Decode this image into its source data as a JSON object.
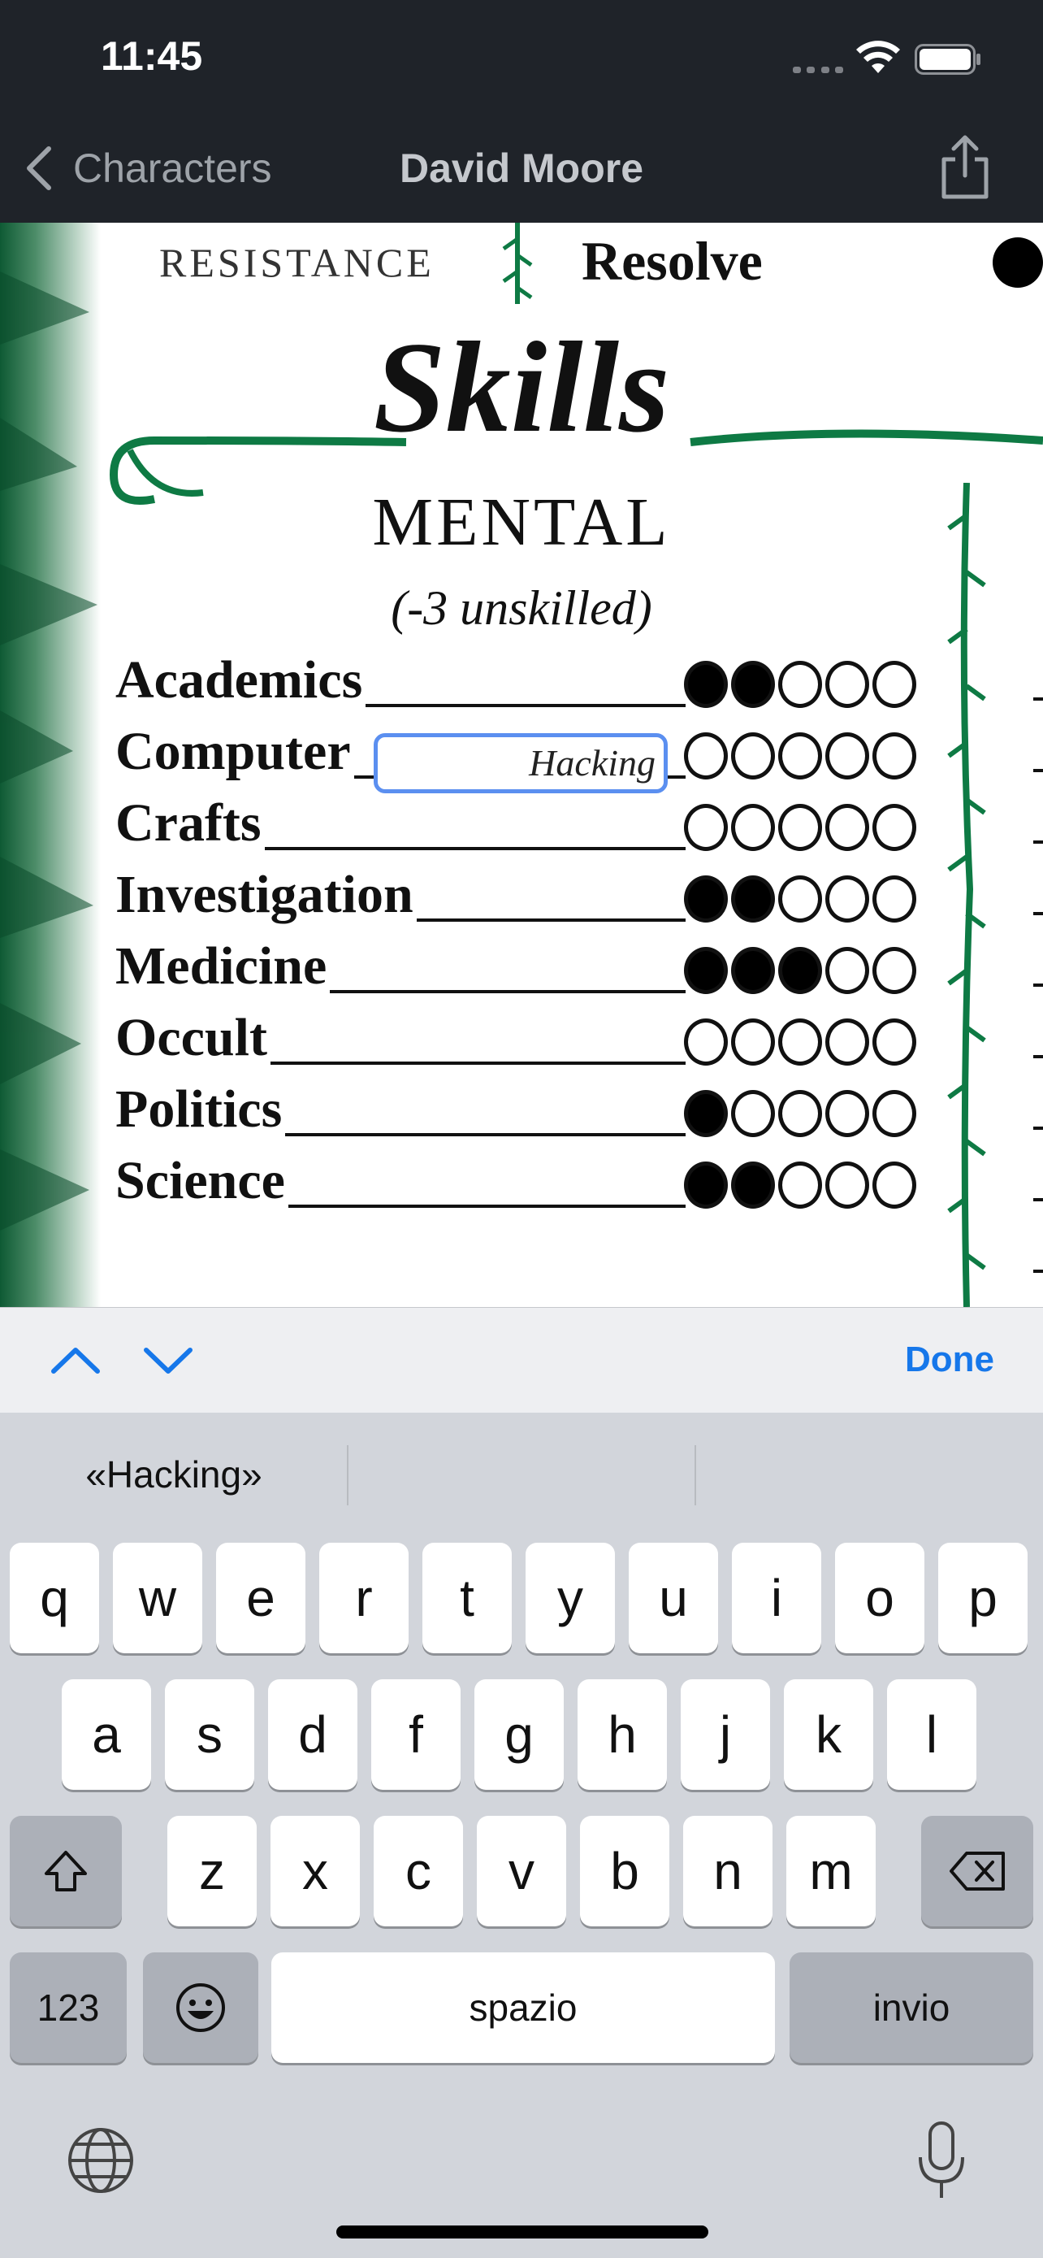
{
  "status_bar": {
    "time": "11:45"
  },
  "nav": {
    "back_label": "Characters",
    "title": "David Moore"
  },
  "sheet": {
    "resistance_label": "RESISTANCE",
    "resolve_label": "Resolve",
    "skills_title": "Skills",
    "category": "MENTAL",
    "unskilled_note": "(-3 unskilled)",
    "skills": [
      {
        "name": "Academics",
        "dots": 2,
        "max": 5
      },
      {
        "name": "Computer",
        "dots": 0,
        "max": 5,
        "specialty": "Hacking"
      },
      {
        "name": "Crafts",
        "dots": 0,
        "max": 5
      },
      {
        "name": "Investigation",
        "dots": 2,
        "max": 5
      },
      {
        "name": "Medicine",
        "dots": 3,
        "max": 5
      },
      {
        "name": "Occult",
        "dots": 0,
        "max": 5
      },
      {
        "name": "Politics",
        "dots": 1,
        "max": 5
      },
      {
        "name": "Science",
        "dots": 2,
        "max": 5
      }
    ]
  },
  "accessory_bar": {
    "done_label": "Done"
  },
  "keyboard": {
    "suggestions": [
      "«Hacking»",
      "",
      ""
    ],
    "row1": [
      "q",
      "w",
      "e",
      "r",
      "t",
      "y",
      "u",
      "i",
      "o",
      "p"
    ],
    "row2": [
      "a",
      "s",
      "d",
      "f",
      "g",
      "h",
      "j",
      "k",
      "l"
    ],
    "row3": [
      "z",
      "x",
      "c",
      "v",
      "b",
      "n",
      "m"
    ],
    "numbers_label": "123",
    "space_label": "spazio",
    "return_label": "invio"
  },
  "colors": {
    "accent": "#1677ea",
    "nav_bg": "#1f2329",
    "focus_ring": "#5b8ff0",
    "ivy": "#0e7a44"
  }
}
